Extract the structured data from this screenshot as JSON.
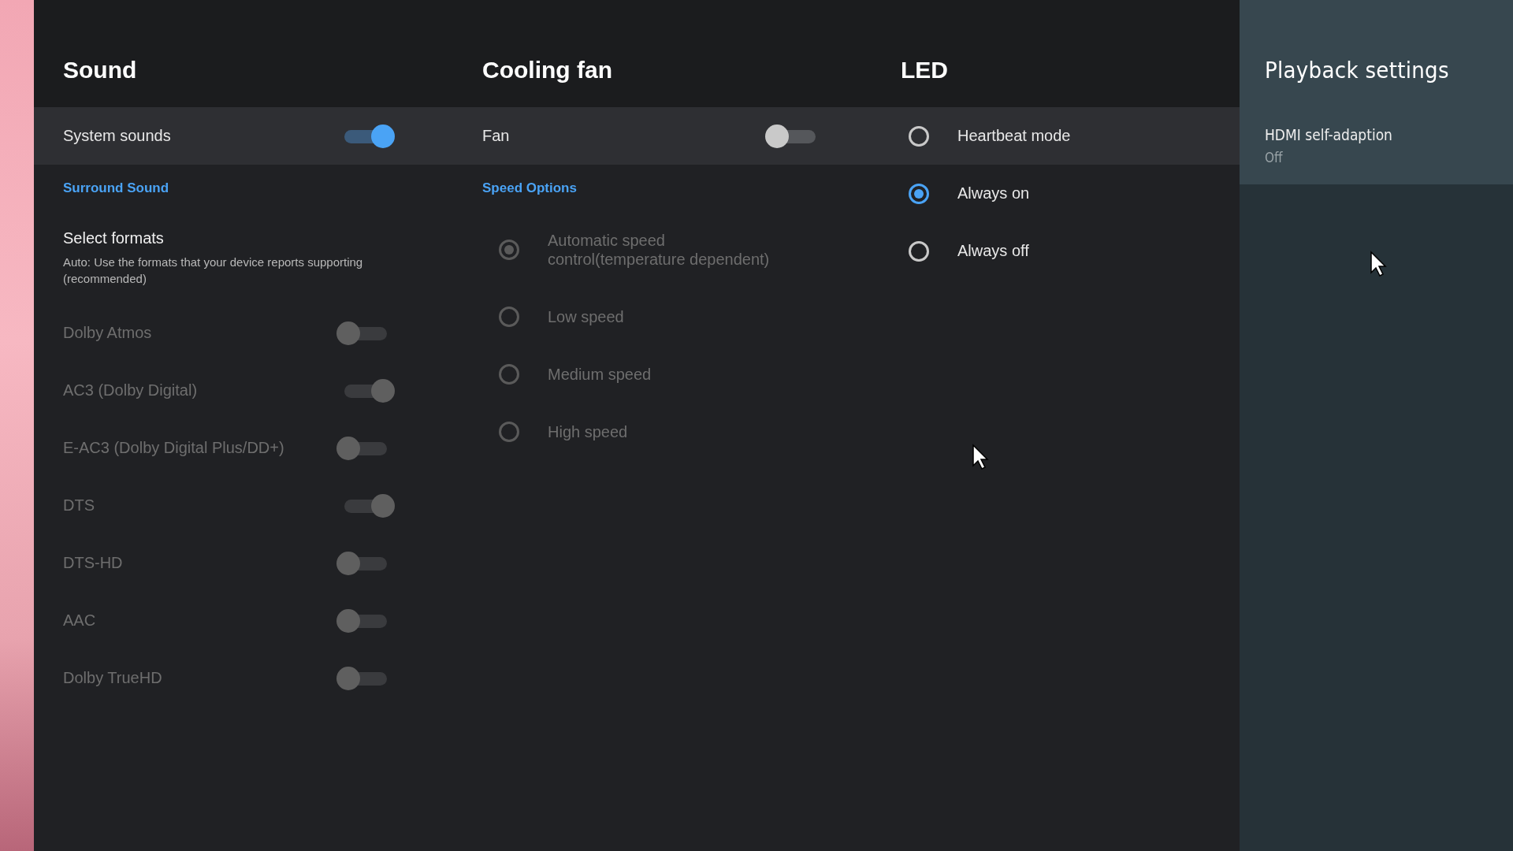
{
  "sound": {
    "title": "Sound",
    "system_sounds": {
      "label": "System sounds",
      "on": true,
      "disabled": false,
      "focused": true
    },
    "section": "Surround Sound",
    "select_formats": {
      "title": "Select formats",
      "subtitle": "Auto: Use the formats that your device reports supporting (recommended)"
    },
    "formats": [
      {
        "label": "Dolby Atmos",
        "on": false,
        "disabled": true
      },
      {
        "label": "AC3 (Dolby Digital)",
        "on": true,
        "disabled": true
      },
      {
        "label": "E-AC3 (Dolby Digital Plus/DD+)",
        "on": false,
        "disabled": true
      },
      {
        "label": "DTS",
        "on": true,
        "disabled": true
      },
      {
        "label": "DTS-HD",
        "on": false,
        "disabled": true
      },
      {
        "label": "AAC",
        "on": false,
        "disabled": true
      },
      {
        "label": "Dolby TrueHD",
        "on": false,
        "disabled": true
      }
    ]
  },
  "cooling_fan": {
    "title": "Cooling fan",
    "fan": {
      "label": "Fan",
      "on": false,
      "disabled": false,
      "focused": true
    },
    "section": "Speed Options",
    "speeds": [
      {
        "label": "Automatic speed control(temperature dependent)",
        "selected": true,
        "disabled": true
      },
      {
        "label": "Low speed",
        "selected": false,
        "disabled": true
      },
      {
        "label": "Medium speed",
        "selected": false,
        "disabled": true
      },
      {
        "label": "High speed",
        "selected": false,
        "disabled": true
      }
    ]
  },
  "led": {
    "title": "LED",
    "modes": [
      {
        "label": "Heartbeat mode",
        "selected": false,
        "disabled": false,
        "focused": true
      },
      {
        "label": "Always on",
        "selected": true,
        "disabled": false,
        "focused": false
      },
      {
        "label": "Always off",
        "selected": false,
        "disabled": false,
        "focused": false
      }
    ]
  },
  "playback": {
    "title": "Playback settings",
    "items": [
      {
        "label": "HDMI self-adaption",
        "value": "Off",
        "focused": true
      }
    ]
  }
}
